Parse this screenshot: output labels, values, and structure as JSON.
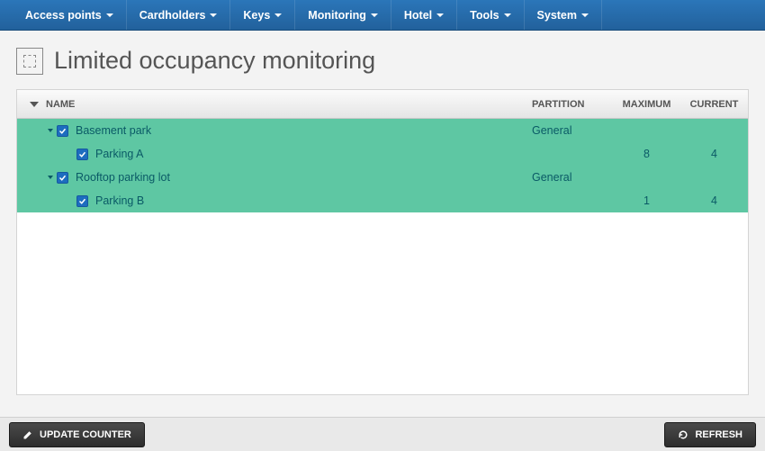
{
  "nav": {
    "items": [
      {
        "label": "Access points"
      },
      {
        "label": "Cardholders"
      },
      {
        "label": "Keys"
      },
      {
        "label": "Monitoring"
      },
      {
        "label": "Hotel"
      },
      {
        "label": "Tools"
      },
      {
        "label": "System"
      }
    ]
  },
  "page": {
    "title": "Limited occupancy monitoring"
  },
  "table": {
    "headers": {
      "name": "NAME",
      "partition": "PARTITION",
      "maximum": "MAXIMUM",
      "current": "CURRENT"
    },
    "groups": [
      {
        "name": "Basement park",
        "partition": "General",
        "children": [
          {
            "name": "Parking A",
            "maximum": "8",
            "current": "4"
          }
        ]
      },
      {
        "name": "Rooftop parking lot",
        "partition": "General",
        "children": [
          {
            "name": "Parking B",
            "maximum": "1",
            "current": "4"
          }
        ]
      }
    ]
  },
  "buttons": {
    "update_counter": "UPDATE COUNTER",
    "refresh": "REFRESH"
  }
}
